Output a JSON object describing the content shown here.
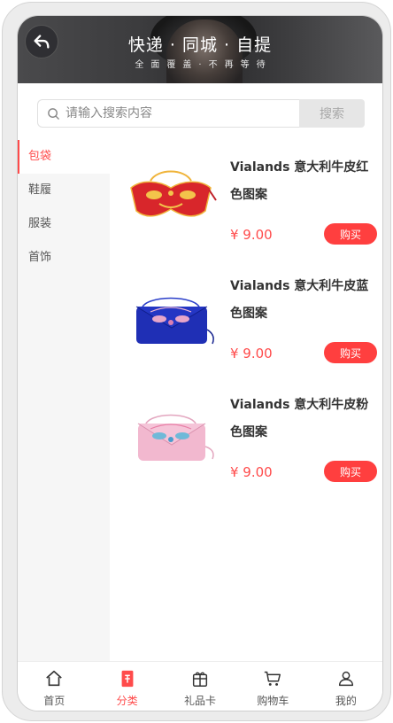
{
  "header": {
    "title": "快递 · 同城 · 自提",
    "subtitle": "全面覆盖·不再等待"
  },
  "search": {
    "placeholder": "请输入搜索内容",
    "value": "",
    "button_label": "搜索"
  },
  "sidebar": {
    "items": [
      {
        "label": "包袋",
        "active": true
      },
      {
        "label": "鞋履",
        "active": false
      },
      {
        "label": "服装",
        "active": false
      },
      {
        "label": "首饰",
        "active": false
      }
    ]
  },
  "products": [
    {
      "name": "Vialands 意大利牛皮红色图案",
      "price": "¥ 9.00",
      "buy_label": "购买",
      "color": "#d8262b"
    },
    {
      "name": "Vialands 意大利牛皮蓝色图案",
      "price": "¥ 9.00",
      "buy_label": "购买",
      "color": "#1f2fb5"
    },
    {
      "name": "Vialands 意大利牛皮粉色图案",
      "price": "¥ 9.00",
      "buy_label": "购买",
      "color": "#f2b8cf"
    }
  ],
  "tabbar": {
    "tabs": [
      {
        "label": "首页",
        "icon": "home-icon",
        "active": false
      },
      {
        "label": "分类",
        "icon": "category-icon",
        "active": true
      },
      {
        "label": "礼品卡",
        "icon": "gift-card-icon",
        "active": false
      },
      {
        "label": "购物车",
        "icon": "cart-icon",
        "active": false
      },
      {
        "label": "我的",
        "icon": "user-icon",
        "active": false
      }
    ]
  },
  "colors": {
    "accent": "#ff4b4b"
  }
}
